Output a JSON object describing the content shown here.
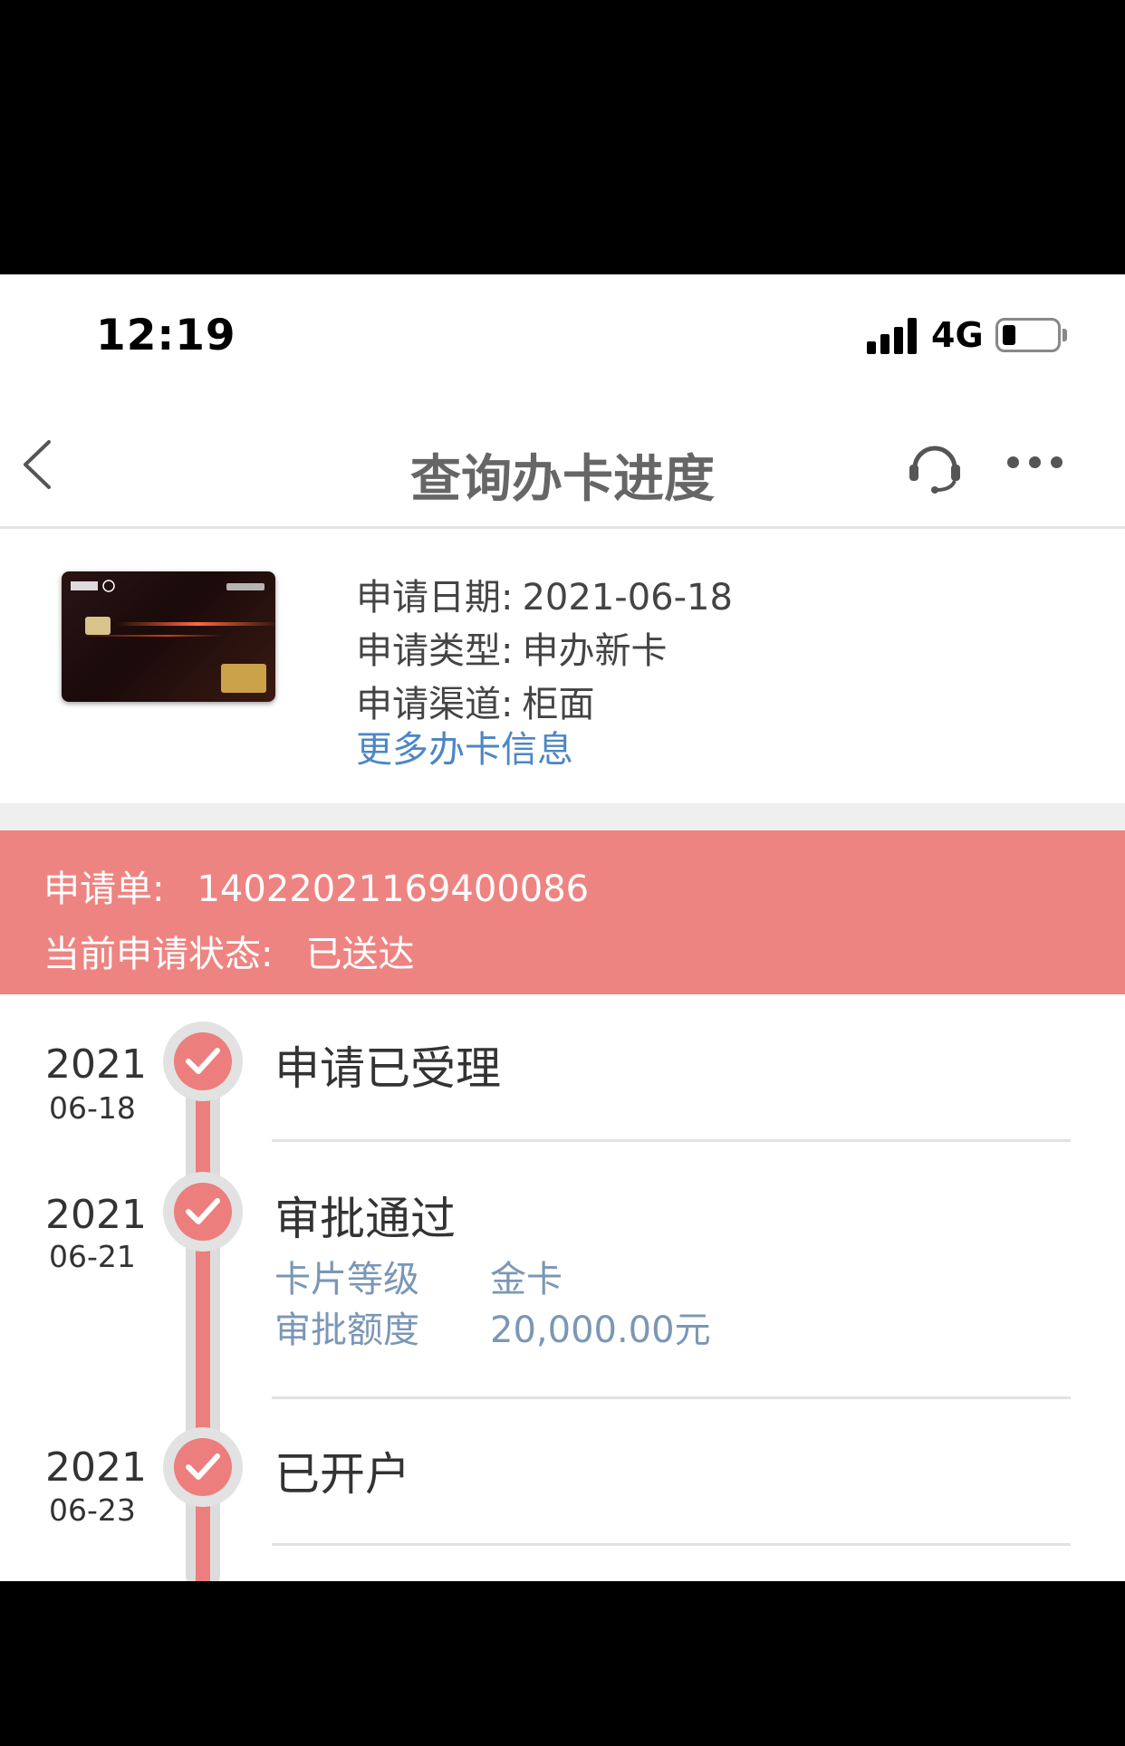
{
  "status_bar": {
    "time": "12:19",
    "network": "4G",
    "battery_level": 0.2
  },
  "nav": {
    "title": "查询办卡进度",
    "icons": [
      "chevron-left-icon",
      "headset-icon",
      "more-icon"
    ]
  },
  "application": {
    "date_label": "申请日期:",
    "date_value": "2021-06-18",
    "type_label": "申请类型:",
    "type_value": "申办新卡",
    "channel_label": "申请渠道:",
    "channel_value": "柜面",
    "more_link": "更多办卡信息"
  },
  "banner": {
    "order_label": "申请单:",
    "order_value": "14022021169400086",
    "status_label": "当前申请状态:",
    "status_value": "已送达",
    "color": "#ee8481"
  },
  "timeline": [
    {
      "year": "2021",
      "date": "06-18",
      "title": "申请已受理"
    },
    {
      "year": "2021",
      "date": "06-21",
      "title": "审批通过",
      "details": [
        {
          "label": "卡片等级",
          "value": "金卡"
        },
        {
          "label": "审批额度",
          "value": "20,000.00元"
        }
      ]
    },
    {
      "year": "2021",
      "date": "06-23",
      "title": "已开户"
    }
  ],
  "accent_color": "#ec7f7d",
  "link_color": "#4d86c6"
}
